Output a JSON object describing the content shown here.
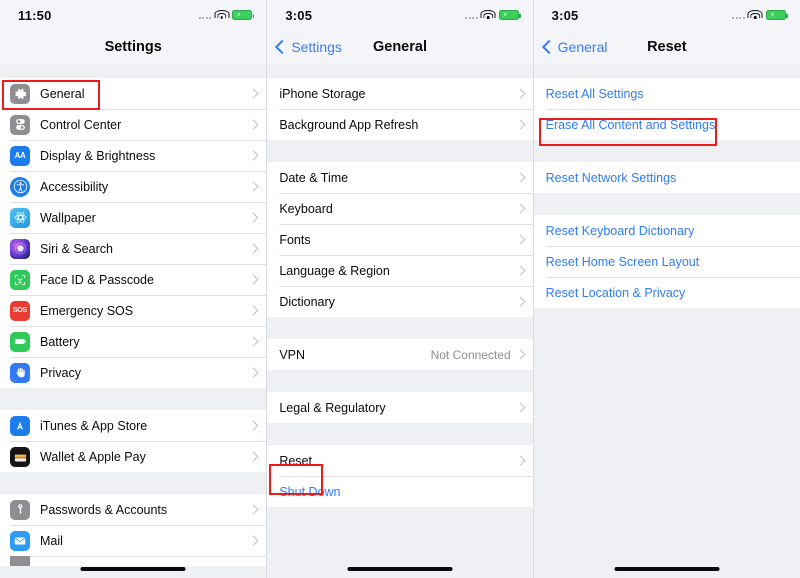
{
  "screens": [
    {
      "id": "settings",
      "status": {
        "time": "11:50",
        "wifi_icon": "wifi-icon",
        "battery_icon": "battery-charging-icon",
        "signal_icon": "signal-dots-icon"
      },
      "nav": {
        "title": "Settings",
        "back": null
      },
      "sections": [
        {
          "rows": [
            {
              "label": "General",
              "icon": "gear-icon",
              "icon_color": "#8e8e93",
              "arrow": true,
              "highlight": true
            },
            {
              "label": "Control Center",
              "icon": "control-center-icon",
              "icon_color": "#8e8e93",
              "arrow": true
            },
            {
              "label": "Display & Brightness",
              "icon": "display-brightness-icon",
              "icon_color": "#1b7ced",
              "arrow": true
            },
            {
              "label": "Accessibility",
              "icon": "accessibility-icon",
              "icon_color": "#1b7ced",
              "arrow": true
            },
            {
              "label": "Wallpaper",
              "icon": "wallpaper-icon",
              "icon_color": "#35b6e8",
              "arrow": true
            },
            {
              "label": "Siri & Search",
              "icon": "siri-icon",
              "icon_color": "#2b1a40",
              "arrow": true
            },
            {
              "label": "Face ID & Passcode",
              "icon": "face-id-icon",
              "icon_color": "#30c95a",
              "arrow": true
            },
            {
              "label": "Emergency SOS",
              "icon": "sos-icon",
              "icon_color": "#eb3b30",
              "arrow": true
            },
            {
              "label": "Battery",
              "icon": "battery-icon",
              "icon_color": "#30c95a",
              "arrow": true
            },
            {
              "label": "Privacy",
              "icon": "privacy-hand-icon",
              "icon_color": "#2f7cf6",
              "arrow": true
            }
          ]
        },
        {
          "rows": [
            {
              "label": "iTunes & App Store",
              "icon": "app-store-icon",
              "icon_color": "#1b7ced",
              "arrow": true
            },
            {
              "label": "Wallet & Apple Pay",
              "icon": "wallet-icon",
              "icon_color": "#141414",
              "arrow": true
            }
          ]
        },
        {
          "rows": [
            {
              "label": "Passwords & Accounts",
              "icon": "key-icon",
              "icon_color": "#8e8e93",
              "arrow": true
            },
            {
              "label": "Mail",
              "icon": "mail-icon",
              "icon_color": "#2f9cf4",
              "arrow": true
            },
            {
              "label": "",
              "icon": "partial-icon",
              "icon_color": "#8e8e93",
              "arrow": false,
              "partial": true
            }
          ]
        }
      ]
    },
    {
      "id": "general",
      "status": {
        "time": "3:05",
        "wifi_icon": "wifi-icon",
        "battery_icon": "battery-charging-icon",
        "signal_icon": "signal-dots-icon"
      },
      "nav": {
        "title": "General",
        "back": "Settings"
      },
      "sections": [
        {
          "rows": [
            {
              "label": "iPhone Storage",
              "arrow": true
            },
            {
              "label": "Background App Refresh",
              "arrow": true
            }
          ]
        },
        {
          "rows": [
            {
              "label": "Date & Time",
              "arrow": true
            },
            {
              "label": "Keyboard",
              "arrow": true
            },
            {
              "label": "Fonts",
              "arrow": true
            },
            {
              "label": "Language & Region",
              "arrow": true
            },
            {
              "label": "Dictionary",
              "arrow": true
            }
          ]
        },
        {
          "rows": [
            {
              "label": "VPN",
              "value": "Not Connected",
              "arrow": true
            }
          ]
        },
        {
          "rows": [
            {
              "label": "Legal & Regulatory",
              "arrow": true
            }
          ]
        },
        {
          "rows": [
            {
              "label": "Reset",
              "arrow": true,
              "highlight": true
            },
            {
              "label": "Shut Down",
              "arrow": false,
              "blue": true
            }
          ]
        }
      ]
    },
    {
      "id": "reset",
      "status": {
        "time": "3:05",
        "wifi_icon": "wifi-icon",
        "battery_icon": "battery-charging-icon",
        "signal_icon": "signal-dots-icon"
      },
      "nav": {
        "title": "Reset",
        "back": "General"
      },
      "sections": [
        {
          "rows": [
            {
              "label": "Reset All Settings",
              "blue": true,
              "arrow": false
            },
            {
              "label": "Erase All Content and Settings",
              "blue": true,
              "arrow": false,
              "highlight": true
            }
          ]
        },
        {
          "rows": [
            {
              "label": "Reset Network Settings",
              "blue": true,
              "arrow": false
            }
          ]
        },
        {
          "rows": [
            {
              "label": "Reset Keyboard Dictionary",
              "blue": true,
              "arrow": false
            },
            {
              "label": "Reset Home Screen Layout",
              "blue": true,
              "arrow": false
            },
            {
              "label": "Reset Location & Privacy",
              "blue": true,
              "arrow": false
            }
          ]
        }
      ]
    }
  ],
  "colors": {
    "accent_blue": "#2f7cf6",
    "highlight_red": "#ef1a1a",
    "background": "#eef0f4",
    "row_background": "#ffffff",
    "secondary_text": "#8e8e93"
  }
}
